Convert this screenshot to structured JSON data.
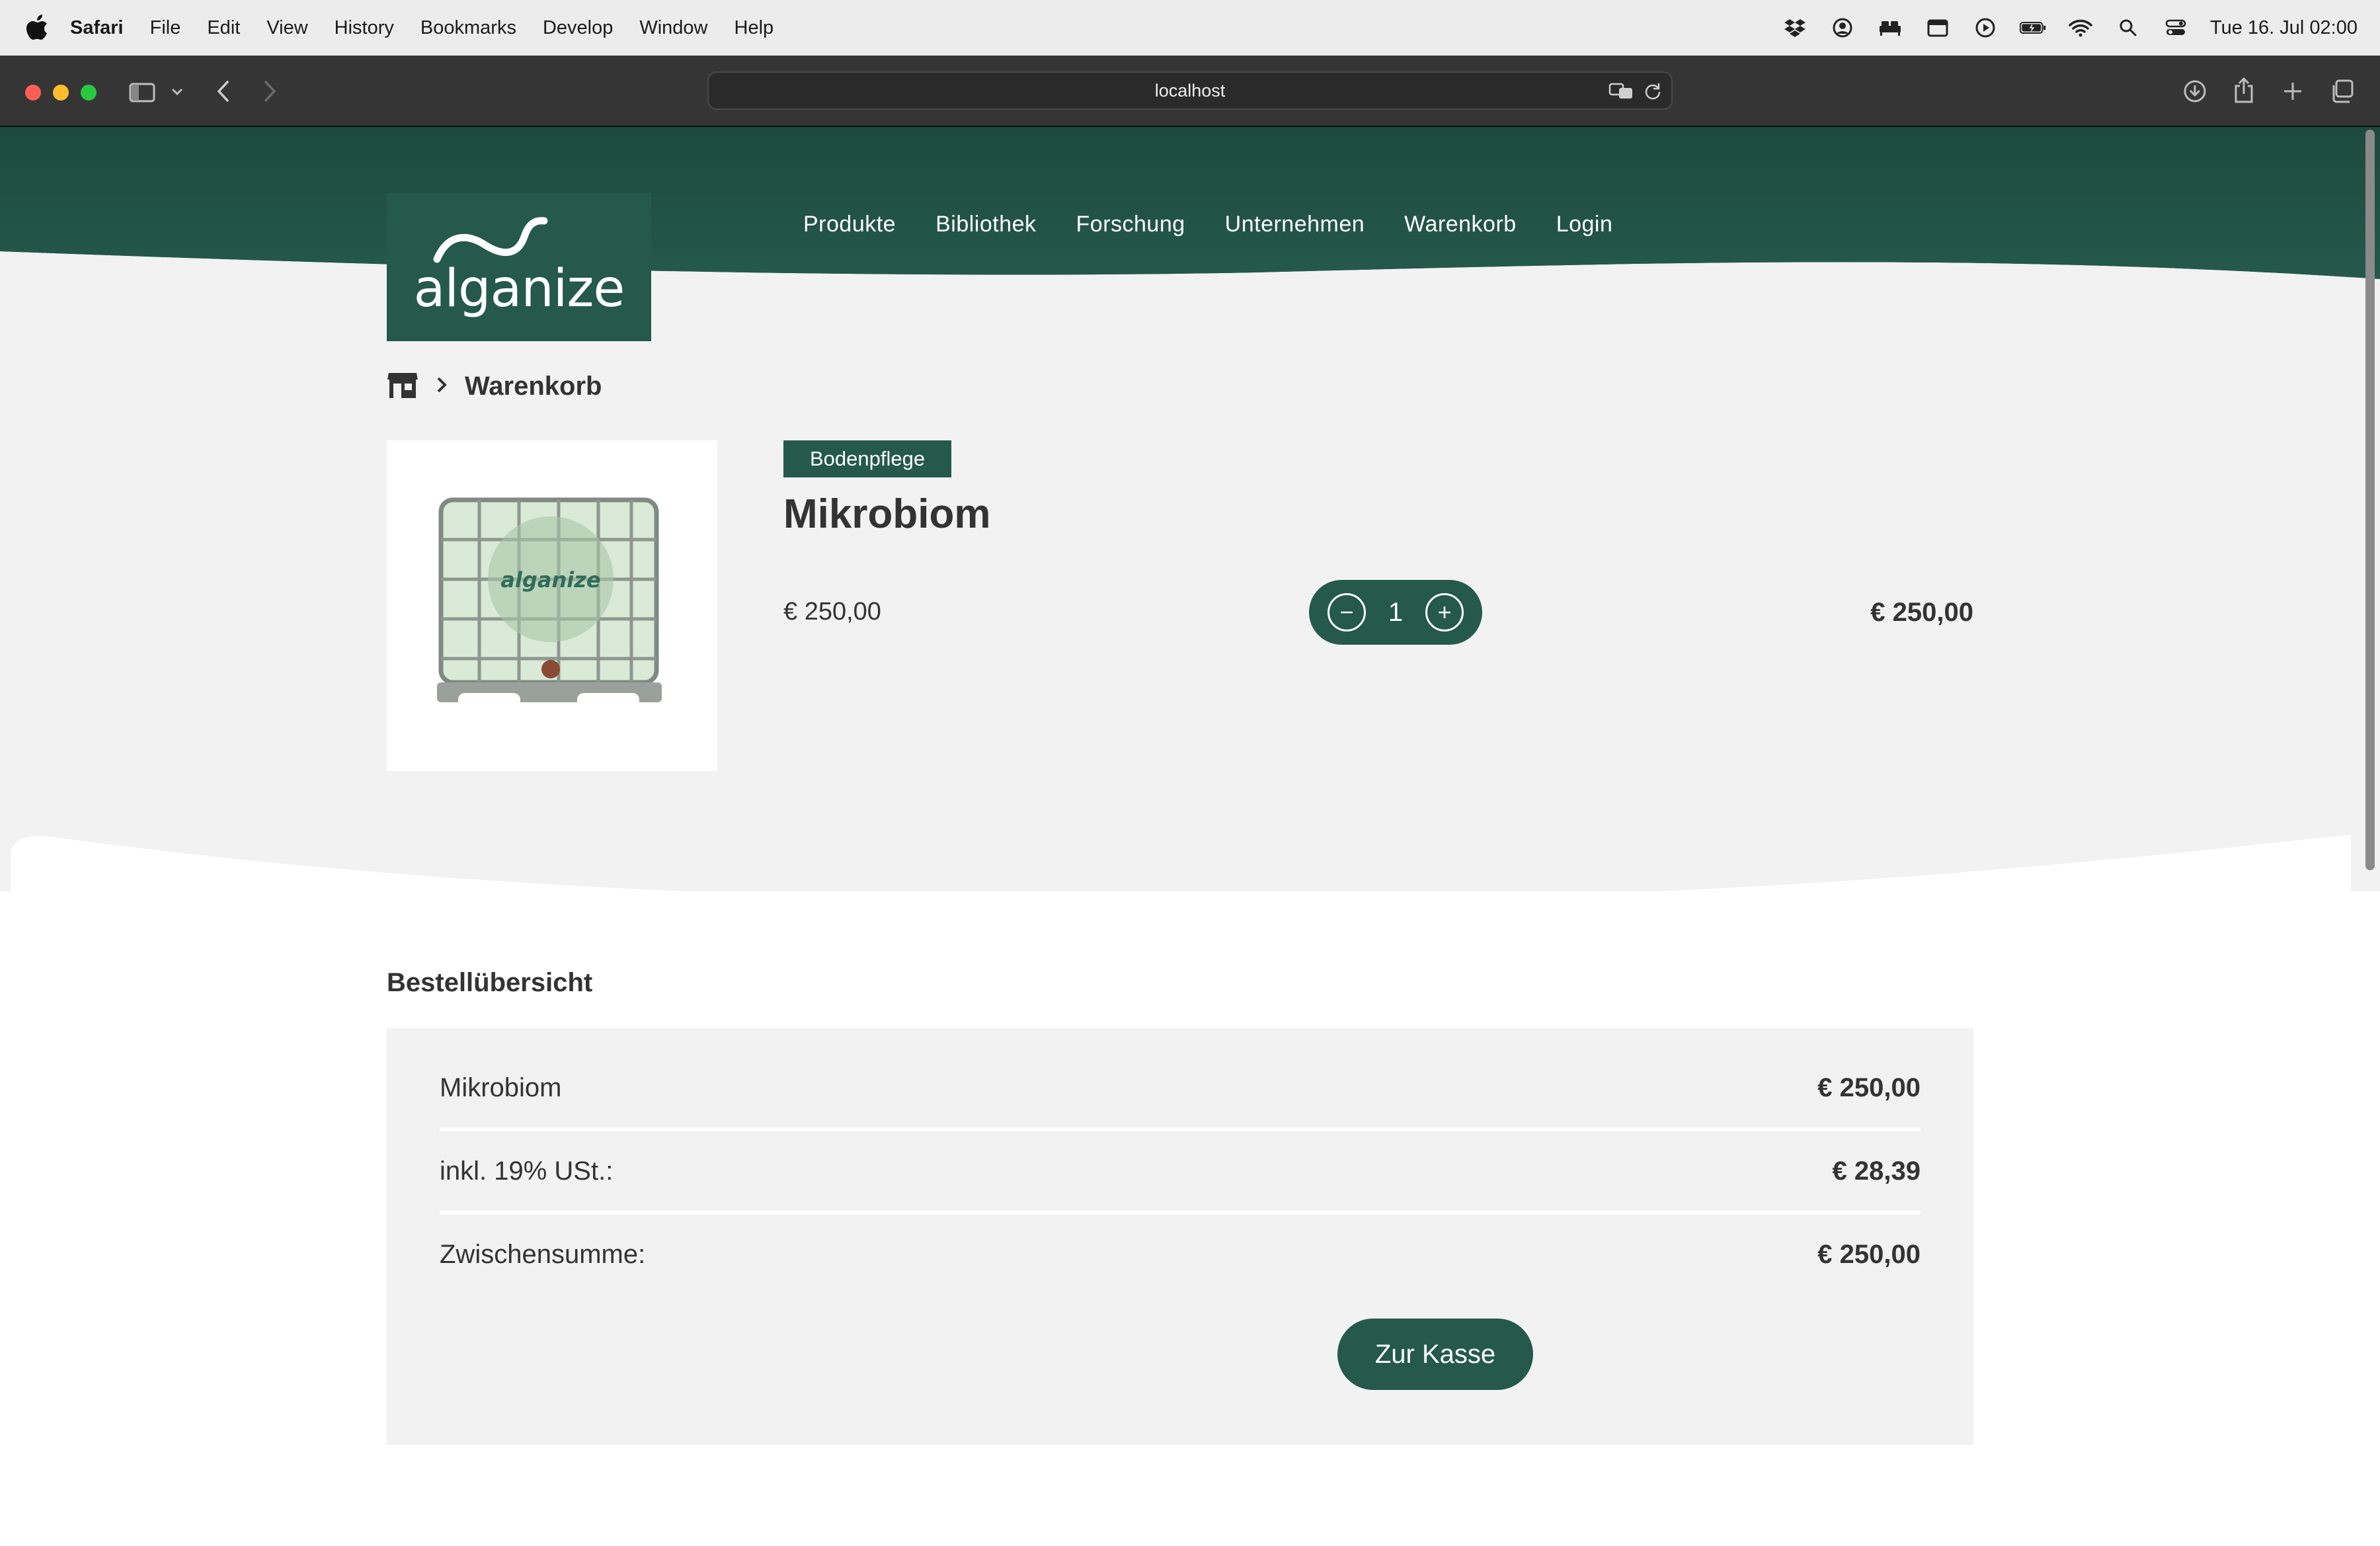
{
  "menubar": {
    "app_name": "Safari",
    "items": [
      "File",
      "Edit",
      "View",
      "History",
      "Bookmarks",
      "Develop",
      "Window",
      "Help"
    ],
    "status_icons": [
      "dropbox-icon",
      "user-icon",
      "bed-icon",
      "calendar-icon",
      "play-icon",
      "battery-icon",
      "wifi-icon",
      "search-icon",
      "control-center-icon"
    ],
    "clock": "Tue 16. Jul  02:00"
  },
  "browser": {
    "url": "localhost"
  },
  "site": {
    "logo_text": "alganize",
    "nav": [
      "Produkte",
      "Bibliothek",
      "Forschung",
      "Unternehmen",
      "Warenkorb",
      "Login"
    ],
    "brand_color": "#24594b"
  },
  "breadcrumb": {
    "current": "Warenkorb"
  },
  "cart_item": {
    "category": "Bodenpflege",
    "name": "Mikrobiom",
    "image_label": "alganize",
    "unit_price": "€ 250,00",
    "quantity": "1",
    "minus": "−",
    "plus": "+",
    "total": "€ 250,00"
  },
  "summary": {
    "heading": "Bestellübersicht",
    "rows": [
      {
        "label": "Mikrobiom",
        "value": "€ 250,00"
      },
      {
        "label": "inkl. 19% USt.:",
        "value": "€ 28,39"
      },
      {
        "label": "Zwischensumme:",
        "value": "€ 250,00"
      }
    ],
    "checkout_label": "Zur Kasse"
  }
}
